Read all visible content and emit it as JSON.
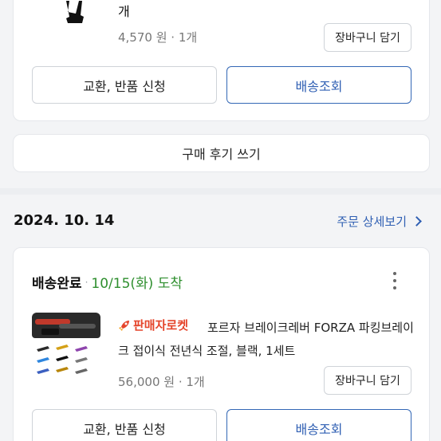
{
  "prev_order": {
    "product_name_tail": "개",
    "price": "4,570 원",
    "quantity": "1개",
    "add_to_cart_label": "장바구니 담기",
    "exchange_return_label": "교환, 반품 신청",
    "track_shipment_label": "배송조회"
  },
  "write_review_label": "구매 후기 쓰기",
  "order": {
    "date": "2024. 10. 14",
    "detail_link_label": "주문 상세보기",
    "status": "배송완료",
    "arrival": "10/15(화) 도착",
    "seller_badge": "판매자로켓",
    "product_name": "포르자 브레이크레버 FORZA 파킹브레이크 접이식 전년식 조절, 블랙, 1세트",
    "price": "56,000 원",
    "quantity": "1개",
    "add_to_cart_label": "장바구니 담기",
    "exchange_return_label": "교환, 반품 신청",
    "track_shipment_label": "배송조회"
  },
  "colors": {
    "accent_blue": "#2f5fb3",
    "arrival_green": "#2f8f2f",
    "badge_red": "#e5452b"
  },
  "icons": [
    "product-thumbnail-lever",
    "chevron-right-icon",
    "more-vertical-icon",
    "rocket-icon"
  ]
}
